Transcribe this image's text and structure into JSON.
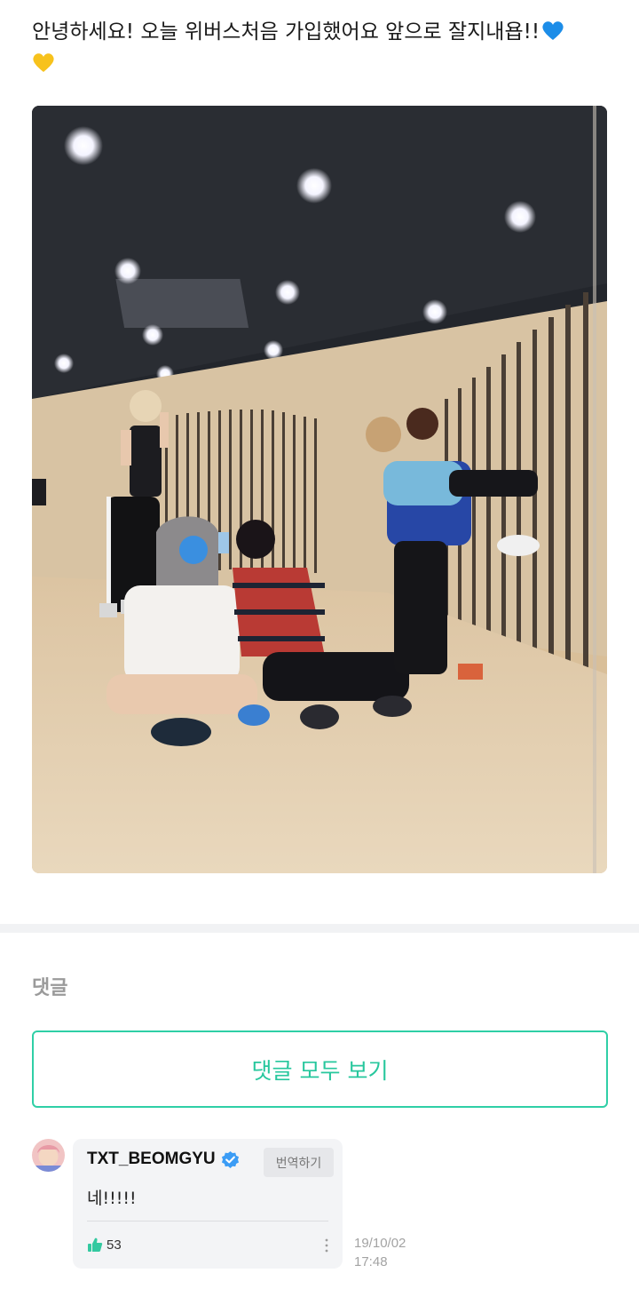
{
  "post": {
    "text": "안녕하세요! 오늘 위버스처음 가입했어요 앞으로 잘지내욥!!",
    "emojis": [
      "blue-heart",
      "yellow-heart"
    ],
    "image_alt": "Five members posing in a mirror at a dance practice room"
  },
  "comments": {
    "title": "댓글",
    "view_all_label": "댓글 모두 보기",
    "items": [
      {
        "author": "TXT_BEOMGYU",
        "verified": true,
        "translate_label": "번역하기",
        "body": "네!!!!!",
        "likes": "53",
        "date": "19/10/02",
        "time": "17:48"
      }
    ]
  },
  "colors": {
    "accent": "#2fcfa6",
    "verified": "#3b9cf5",
    "divider": "#f1f2f4"
  }
}
